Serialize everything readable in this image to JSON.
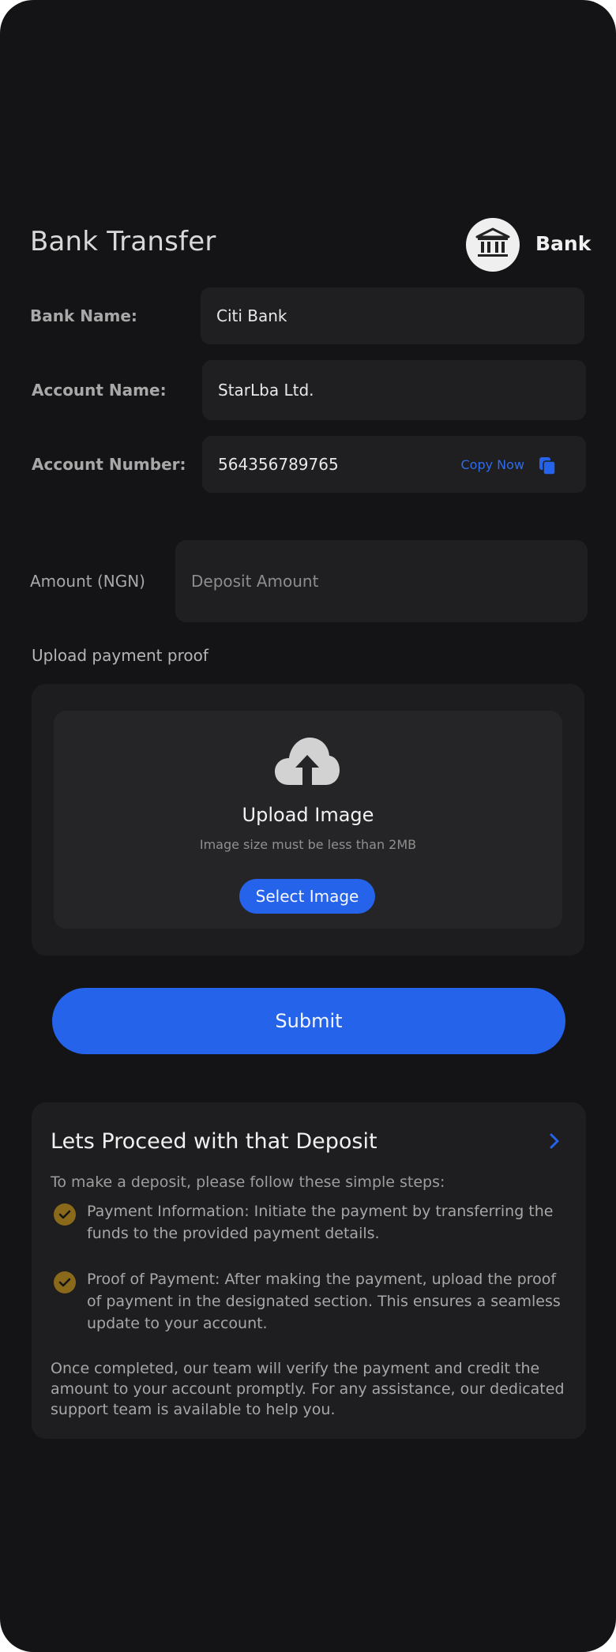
{
  "header": {
    "title": "Bank Transfer",
    "method_label": "Bank",
    "method_icon": "bank-icon"
  },
  "details": [
    {
      "label": "Bank Name:",
      "value": "Citi Bank"
    },
    {
      "label": "Account Name:",
      "value": "StarLba Ltd."
    },
    {
      "label": "Account Number:",
      "value": "564356789765",
      "copy_label": "Copy Now",
      "copy_icon": "copy-icon"
    }
  ],
  "amount": {
    "label": "Amount (NGN)",
    "placeholder": "Deposit Amount",
    "value": ""
  },
  "upload": {
    "section_label": "Upload payment proof",
    "icon": "cloud-upload-icon",
    "title": "Upload Image",
    "hint": "Image size must be less than 2MB",
    "button_label": "Select Image"
  },
  "submit_label": "Submit",
  "info": {
    "title": "Lets Proceed with that Deposit",
    "intro": "To make a deposit, please follow these simple steps:",
    "steps": [
      "Payment Information: Initiate the payment by transferring the funds to the provided payment details.",
      "Proof of Payment: After making the payment, upload the proof of payment in the designated section. This ensures a seamless update to your account."
    ],
    "outro": "Once completed, our team will verify the payment and credit the amount to your account promptly. For any assistance, our dedicated support team is available to help you."
  },
  "colors": {
    "background": "#141416",
    "field": "#1f1f21",
    "accent": "#2563eb",
    "check": "#8a6a1a"
  }
}
